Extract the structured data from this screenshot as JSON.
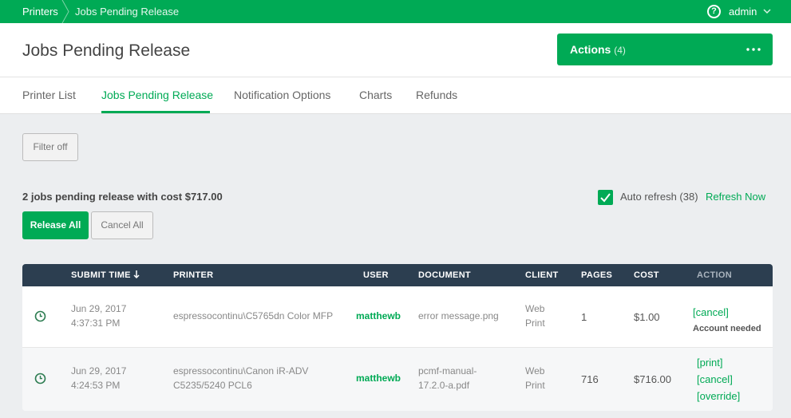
{
  "breadcrumb": {
    "root": "Printers",
    "current": "Jobs Pending Release"
  },
  "user": {
    "name": "admin"
  },
  "header": {
    "title": "Jobs Pending Release",
    "actions_label": "Actions",
    "actions_count": "(4)"
  },
  "tabs": [
    {
      "label": "Printer List"
    },
    {
      "label": "Jobs Pending Release"
    },
    {
      "label": "Notification Options"
    },
    {
      "label": "Charts"
    },
    {
      "label": "Refunds"
    }
  ],
  "filter": {
    "label": "Filter off"
  },
  "summary": {
    "prefix": "2 jobs pending release",
    "middle": " with cost ",
    "cost": "$717.00"
  },
  "auto_refresh": {
    "label": "Auto refresh (38)",
    "refresh_now": "Refresh Now",
    "checked": true
  },
  "buttons": {
    "release_all": "Release All",
    "cancel_all": "Cancel All"
  },
  "table": {
    "headers": {
      "submit_time": "SUBMIT TIME",
      "printer": "PRINTER",
      "user": "USER",
      "document": "DOCUMENT",
      "client": "CLIENT",
      "pages": "PAGES",
      "cost": "COST",
      "action": "ACTION"
    },
    "rows": [
      {
        "date": "Jun 29, 2017",
        "time": "4:37:31 PM",
        "printer_line1": "espressocontinu\\C5765dn Color MFP",
        "printer_line2": "",
        "user": "matthewb",
        "document_line1": "error message.png",
        "document_line2": "",
        "client_line1": "Web",
        "client_line2": "Print",
        "pages": "1",
        "cost": "$1.00",
        "actions": [
          "[cancel]"
        ],
        "note": "Account needed"
      },
      {
        "date": "Jun 29, 2017",
        "time": "4:24:53 PM",
        "printer_line1": "espressocontinu\\Canon iR-ADV",
        "printer_line2": "C5235/5240 PCL6",
        "user": "matthewb",
        "document_line1": "pcmf-manual-",
        "document_line2": "17.2.0-a.pdf",
        "client_line1": "Web",
        "client_line2": "Print",
        "pages": "716",
        "cost": "$716.00",
        "actions": [
          "[print]",
          "[cancel]",
          "[override]"
        ],
        "note": ""
      }
    ]
  },
  "colors": {
    "brand": "#00aa55",
    "table_header": "#2c3e50",
    "background": "#eceef0"
  }
}
